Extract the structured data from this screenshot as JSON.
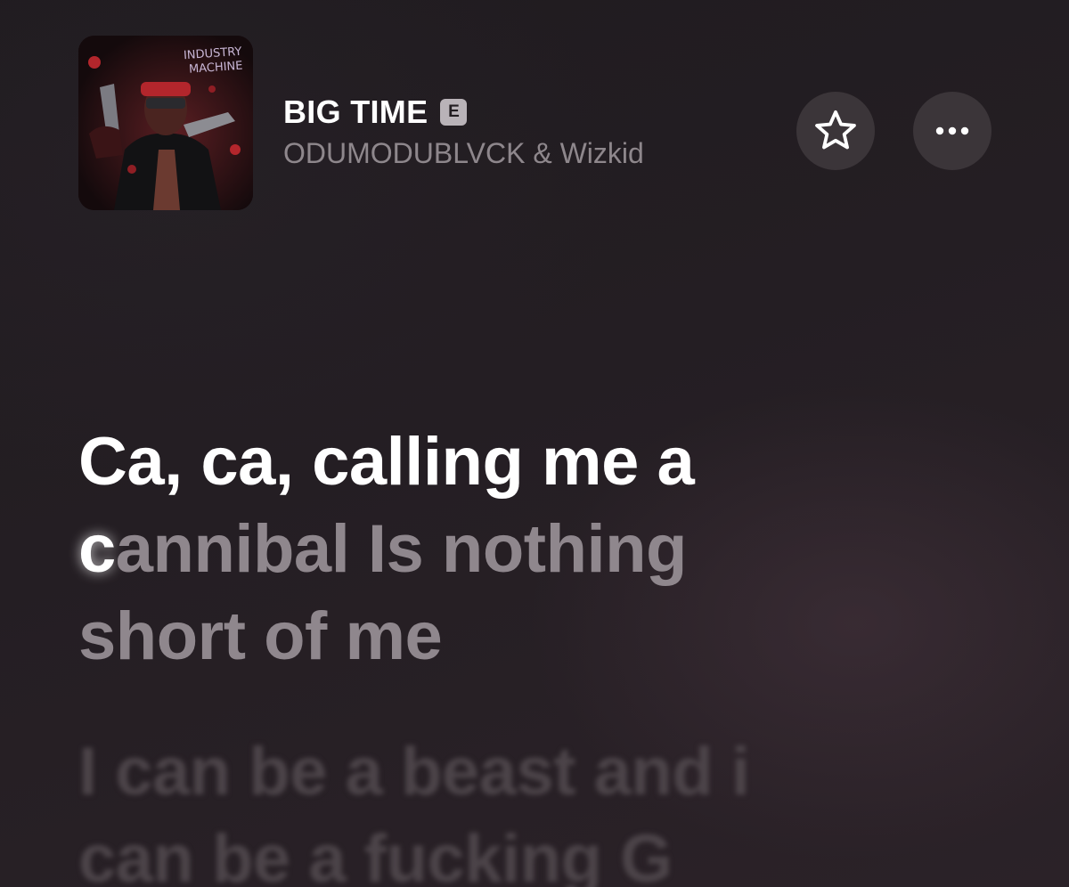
{
  "track": {
    "title": "BIG TIME",
    "explicit_badge": "E",
    "artists": "ODUMODUBLVCK & Wizkid",
    "artwork_text": "INDUSTRY MACHINE"
  },
  "actions": {
    "favorite_icon": "star-outline-icon",
    "more_icon": "ellipsis-icon"
  },
  "lyrics": {
    "active": {
      "line1": "Ca, ca, calling me a",
      "line2_sung": "c",
      "line2_unsung": "annibal Is nothing",
      "line3": "short of me"
    },
    "next": {
      "line1": "I can be a beast and i",
      "line2": "can be a fucking G"
    }
  },
  "colors": {
    "background": "#221d21",
    "title": "#ffffff",
    "artist": "#8e878c",
    "active_lyric": "#ffffff",
    "unsung_lyric": "#8f878d",
    "upcoming_lyric": "#4c4449",
    "button_fill": "#3b3539"
  }
}
